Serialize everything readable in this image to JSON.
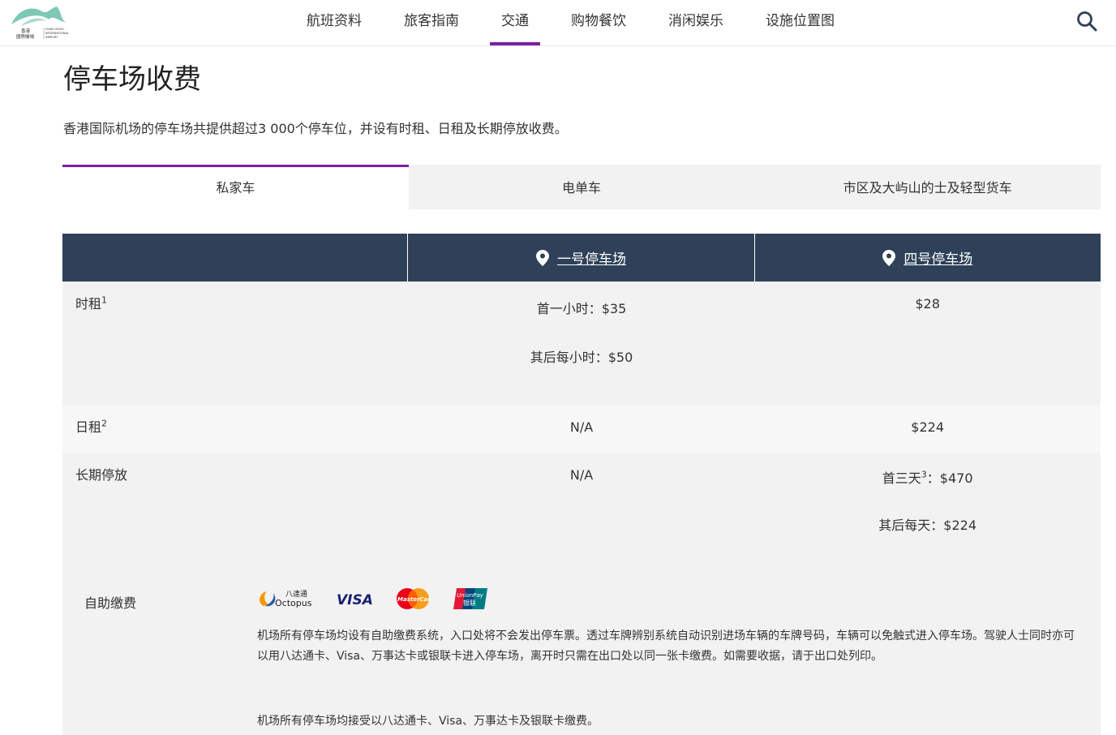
{
  "header": {
    "logo_text": [
      "香港",
      "國際機場",
      "HONG KONG",
      "INTERNATIONAL",
      "AIRPORT"
    ],
    "nav": [
      {
        "label": "航班资料",
        "active": false
      },
      {
        "label": "旅客指南",
        "active": false
      },
      {
        "label": "交通",
        "active": true
      },
      {
        "label": "购物餐饮",
        "active": false
      },
      {
        "label": "消闲娱乐",
        "active": false
      },
      {
        "label": "设施位置图",
        "active": false
      }
    ],
    "search_icon": "search-icon"
  },
  "page": {
    "title": "停车场收费",
    "intro": "香港国际机场的停车场共提供超过3 000个停车位，并设有时租、日租及长期停放收费。"
  },
  "tabs": [
    {
      "label": "私家车",
      "active": true
    },
    {
      "label": "电单车",
      "active": false
    },
    {
      "label": "市区及大屿山的士及轻型货车",
      "active": false
    }
  ],
  "table": {
    "columns": [
      "一号停车场",
      "四号停车场"
    ],
    "rows": [
      {
        "label": "时租",
        "sup": "1",
        "c1": [
          "首一小时：$35",
          "其后每小时：$50"
        ],
        "c2": [
          "$28"
        ]
      },
      {
        "label": "日租",
        "sup": "2",
        "c1": [
          "N/A"
        ],
        "c2": [
          "$224"
        ]
      },
      {
        "label": "长期停放",
        "sup": "",
        "c1": [
          "N/A"
        ],
        "c2_first": "首三天",
        "c2_first_sup": "3",
        "c2_first_value": "：$470",
        "c2_second": "其后每天：$224"
      }
    ]
  },
  "payment": {
    "label": "自助缴费",
    "logos": {
      "octopus_cn": "八達通",
      "octopus_en": "Octopus",
      "visa": "VISA",
      "mastercard": "MasterCard",
      "unionpay_en": "UnionPay",
      "unionpay_cn": "银联"
    },
    "text": "机场所有停车场均设有自助缴费系统，入口处将不会发出停车票。透过车牌辨别系统自动识别进场车辆的车牌号码，车辆可以免触式进入停车场。驾驶人士同时亦可以用八达通卡、Visa、万事达卡或银联卡进入停车场，离开时只需在出口处以同一张卡缴费。如需要收据，请于出口处列印。",
    "text2": "机场所有停车场均接受以八达通卡、Visa、万事达卡及银联卡缴费。"
  },
  "colors": {
    "accent": "#7b1fa2",
    "table_header": "#2e4159",
    "row_bg": "#f2f2f2"
  }
}
